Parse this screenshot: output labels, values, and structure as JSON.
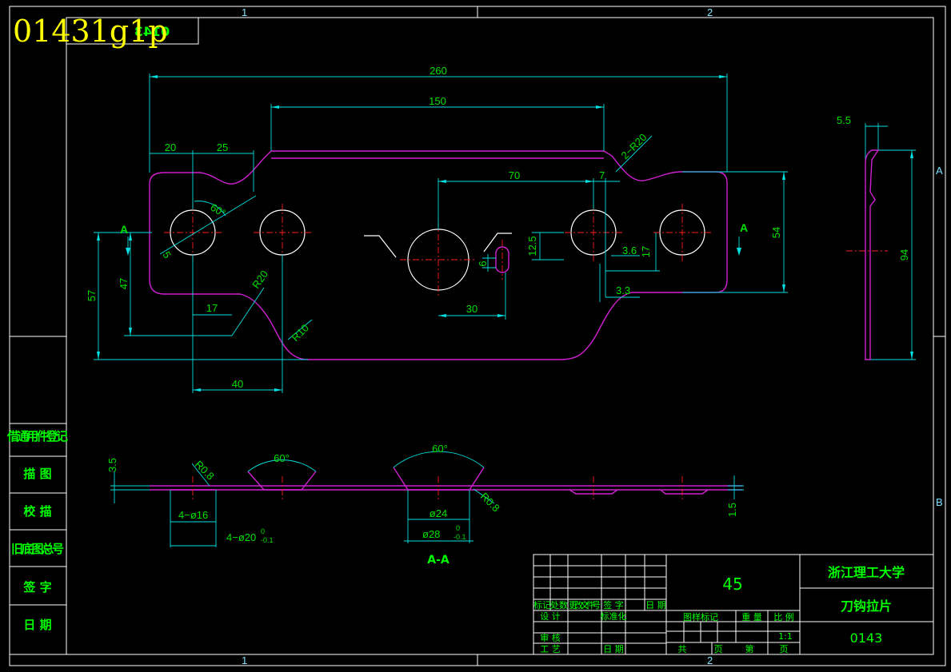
{
  "header": {
    "drawing_code_overlay": "01431g1p",
    "mirrored_code": "0143",
    "zone_top_1": "1",
    "zone_top_2": "2",
    "zone_bottom_1": "1",
    "zone_bottom_2": "2",
    "zone_right_a": "A",
    "zone_right_b": "B"
  },
  "left_table": {
    "rows": [
      "借通用件登记",
      "描 图",
      "校 描",
      "旧底图总号",
      "签 字",
      "日 期"
    ]
  },
  "dimensions": {
    "overall_length": "260",
    "top_span": "150",
    "d20": "20",
    "d25": "25",
    "r20_top": "2−R20",
    "angle60_top": "60°",
    "d5": "5",
    "d70": "70",
    "d7": "7",
    "d54": "54",
    "d12_5": "12.5",
    "d3_6": "3.6",
    "d17_right": "17",
    "d6": "6",
    "d3_3": "3.3",
    "d30": "30",
    "d57": "57",
    "d47": "47",
    "d17_left": "17",
    "r20_left": "R20",
    "r10": "R10",
    "d40": "40",
    "d5_5": "5.5",
    "d94": "94",
    "section_a_left": "A",
    "section_a_right": "A"
  },
  "section_view": {
    "label": "A-A",
    "d3_5": "3.5",
    "r0_8_left": "R0.8",
    "angle60_left": "60°",
    "angle60_mid": "60°",
    "r0_8_right": "R0.8",
    "hole16": "4−ø16",
    "hole20": "4−ø20",
    "hole20_upper": "0",
    "hole20_lower": "-0.1",
    "d24": "ø24",
    "d28": "ø28",
    "d28_upper": "0",
    "d28_lower": "-0.1",
    "d1_5": "1.5"
  },
  "title_block": {
    "material": "45",
    "school": "浙江理工大学",
    "part_name": "刀钩拉片",
    "drawing_no": "0143",
    "scale": "1:1",
    "rev_headers": [
      "标记",
      "处数",
      "更改文件号",
      "签 字",
      "日 期"
    ],
    "design": "设 计",
    "standardize": "标准化",
    "review": "审 核",
    "process": "工 艺",
    "date": "日 期",
    "stage_mark": "图样标记",
    "weight": "重 量",
    "ratio": "比 例",
    "total": "共",
    "sheet_unit": "页",
    "sheet_no": "第",
    "sheet_unit2": "页"
  },
  "colors": {
    "part_outline": "#d020d0",
    "dimension": "#00e0e0",
    "centerline": "#ff2020",
    "text_green": "#00ff00",
    "overlay_yellow": "#ffff00"
  }
}
